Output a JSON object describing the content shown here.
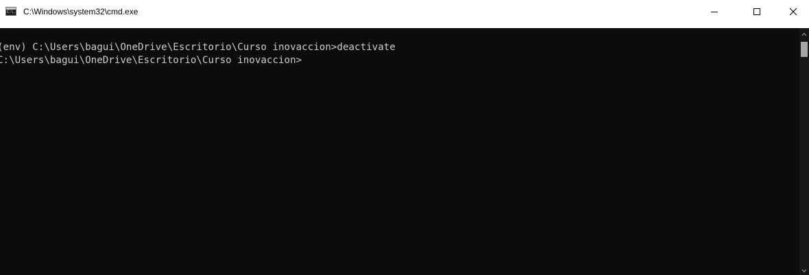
{
  "window": {
    "title": "C:\\Windows\\system32\\cmd.exe",
    "app_icon_text": "C:\\."
  },
  "terminal": {
    "lines": [
      "(env) C:\\Users\\bagui\\OneDrive\\Escritorio\\Curso inovaccion>deactivate",
      "C:\\Users\\bagui\\OneDrive\\Escritorio\\Curso inovaccion>"
    ]
  },
  "colors": {
    "background": "#0c0c0c",
    "foreground": "#cccccc",
    "titlebar": "#ffffff"
  },
  "icons": {
    "minimize": "minimize-icon",
    "maximize": "maximize-icon",
    "close": "close-icon",
    "scroll_up": "chevron-up-icon",
    "scroll_down": "chevron-down-icon"
  }
}
